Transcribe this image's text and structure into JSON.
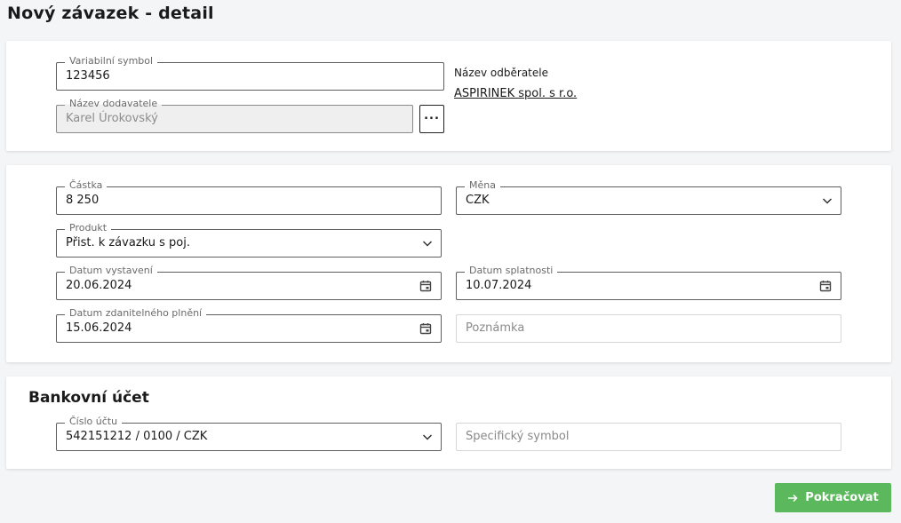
{
  "page": {
    "title": "Nový závazek - detail"
  },
  "card1": {
    "variable_symbol": {
      "label": "Variabilní symbol",
      "value": "123456"
    },
    "supplier_name": {
      "label": "Název dodavatele",
      "value": "Karel Úrokovský"
    },
    "browse_button": "...",
    "customer": {
      "label": "Název odběratele",
      "value": "ASPIRINEK spol. s r.o."
    }
  },
  "card2": {
    "amount": {
      "label": "Částka",
      "value": "8 250"
    },
    "currency": {
      "label": "Měna",
      "value": "CZK"
    },
    "product": {
      "label": "Produkt",
      "value": "Přist. k závazku s poj."
    },
    "issue_date": {
      "label": "Datum vystavení",
      "value": "20.06.2024"
    },
    "due_date": {
      "label": "Datum splatnosti",
      "value": "10.07.2024"
    },
    "taxable_date": {
      "label": "Datum zdanitelného plnění",
      "value": "15.06.2024"
    },
    "note": {
      "placeholder": "Poznámka"
    }
  },
  "card3": {
    "title": "Bankovní účet",
    "account": {
      "label": "Číslo účtu",
      "value": "542151212 / 0100 / CZK"
    },
    "specific_symbol": {
      "placeholder": "Specifický symbol"
    }
  },
  "actions": {
    "continue_label": "Pokračovat"
  },
  "icons": {
    "chevron": "chevron-down-icon",
    "calendar": "calendar-icon",
    "arrow": "arrow-right-icon"
  },
  "colors": {
    "accent": "#5cb85c",
    "border": "#5e5e5e",
    "background": "#f4f5f7"
  }
}
